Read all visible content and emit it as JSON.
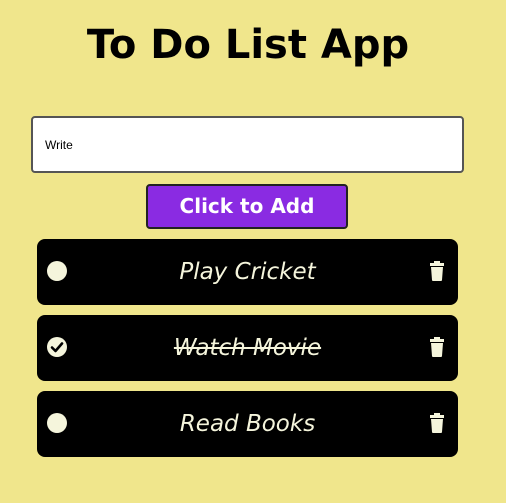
{
  "app": {
    "title": "To Do List App"
  },
  "input": {
    "value": "Write",
    "placeholder": ""
  },
  "add_button": {
    "label": "Click to Add"
  },
  "tasks": [
    {
      "label": "Play Cricket",
      "completed": false
    },
    {
      "label": "Watch Movie",
      "completed": true
    },
    {
      "label": "Read Books",
      "completed": false
    }
  ],
  "colors": {
    "background": "#f0e68c",
    "accent": "#8a2be2",
    "task_background": "#000000",
    "task_text": "#f5f5dc"
  },
  "icons": {
    "check": "circle-check-icon",
    "uncheck": "circle-icon",
    "delete": "trash-icon"
  }
}
